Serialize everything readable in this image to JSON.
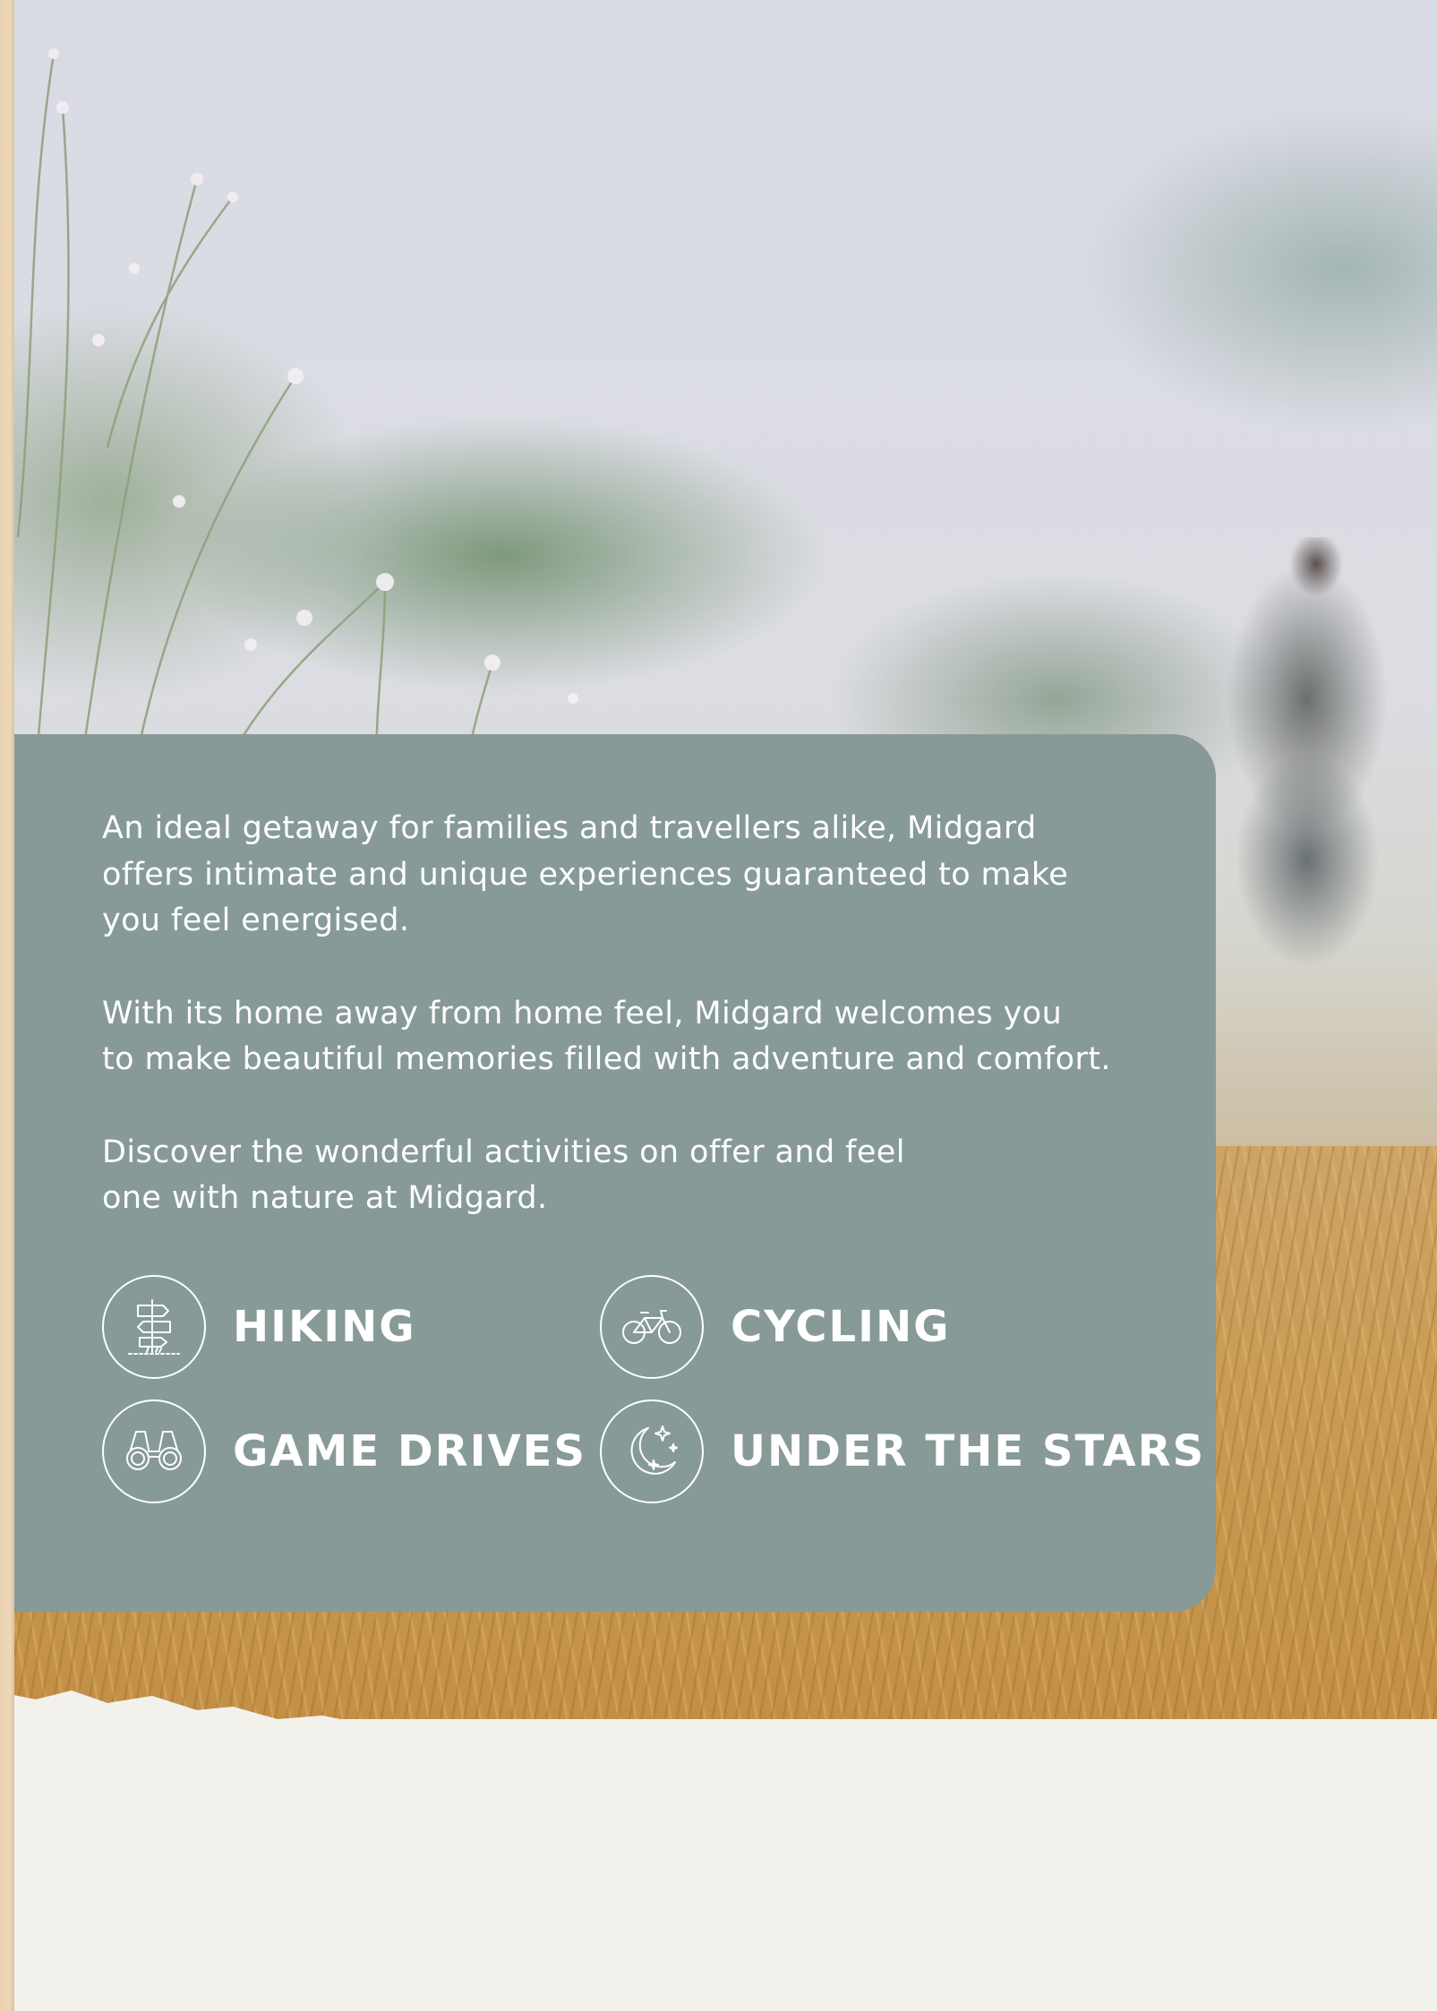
{
  "intro": {
    "paragraphs": [
      "An ideal getaway for families and travellers alike, Midgard offers intimate and unique experiences guaranteed to make you feel energised.",
      "With its home away from home feel, Midgard welcomes you to make beautiful memories filled with adventure and comfort.",
      "Discover the wonderful activities on offer and feel one with nature at Midgard."
    ],
    "lines": [
      [
        "An ideal getaway for families and travellers alike, Midgard",
        "offers intimate and unique experiences guaranteed to make",
        "you feel energised."
      ],
      [
        "With its home away from home feel, Midgard welcomes you",
        "to make beautiful memories filled with adventure and comfort."
      ],
      [
        "Discover the wonderful activities on offer and feel",
        "one with nature at Midgard."
      ]
    ]
  },
  "activities": [
    {
      "label": "HIKING",
      "icon": "signpost-icon"
    },
    {
      "label": "CYCLING",
      "icon": "bicycle-icon"
    },
    {
      "label": "GAME DRIVES",
      "icon": "binoculars-icon"
    },
    {
      "label": "UNDER THE STARS",
      "icon": "moon-stars-icon"
    }
  ],
  "colors": {
    "card": "#879a98",
    "text": "#ffffff",
    "paper": "#f3f1ec",
    "wheat": "#c99a52"
  }
}
